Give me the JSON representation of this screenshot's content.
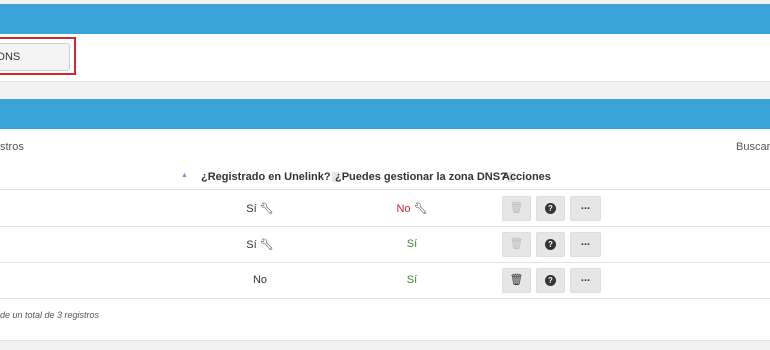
{
  "top_button": {
    "label": "DNS"
  },
  "table": {
    "show_label": "stros",
    "search_label": "Buscar",
    "headers": {
      "registered": "¿Registrado en Unelink?",
      "dns": "¿Puedes gestionar la zona DNS?",
      "actions": "Acciones"
    },
    "rows": [
      {
        "registered": "Sí",
        "dns": "No"
      },
      {
        "registered": "Sí",
        "dns": "Sí"
      },
      {
        "registered": "No",
        "dns": "Sí"
      }
    ],
    "info": "de un total de 3 registros"
  },
  "icons": {
    "sort": "sort-asc-icon",
    "wrench": "wrench-icon",
    "trash": "trash-icon",
    "help": "question-circle-icon",
    "more": "ellipsis-icon"
  },
  "colors": {
    "header_bar": "#3aa3d8",
    "no": "#d9232e",
    "yes": "#3a8a2a",
    "highlight": "#d9232e"
  }
}
